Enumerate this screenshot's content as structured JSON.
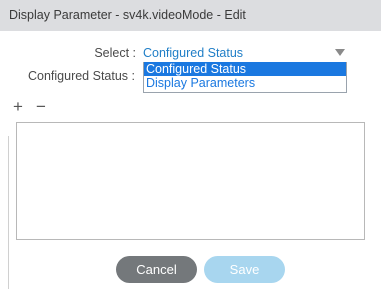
{
  "dialog": {
    "title": "Display Parameter - sv4k.videoMode - Edit"
  },
  "form": {
    "select_label": "Select :",
    "select_value": "Configured Status",
    "configured_status_label": "Configured Status :",
    "options": [
      "Configured Status",
      "Display Parameters"
    ],
    "selected_option_index": 0
  },
  "toolbar": {
    "add_glyph": "+",
    "remove_glyph": "−"
  },
  "buttons": {
    "cancel_label": "Cancel",
    "save_label": "Save"
  },
  "colors": {
    "link_blue": "#1f7ec7",
    "selection_blue": "#1a78e0",
    "cancel_gray": "#74787b",
    "save_disabled_blue": "#a8d6ef",
    "titlebar_gray": "#dcdde0"
  }
}
